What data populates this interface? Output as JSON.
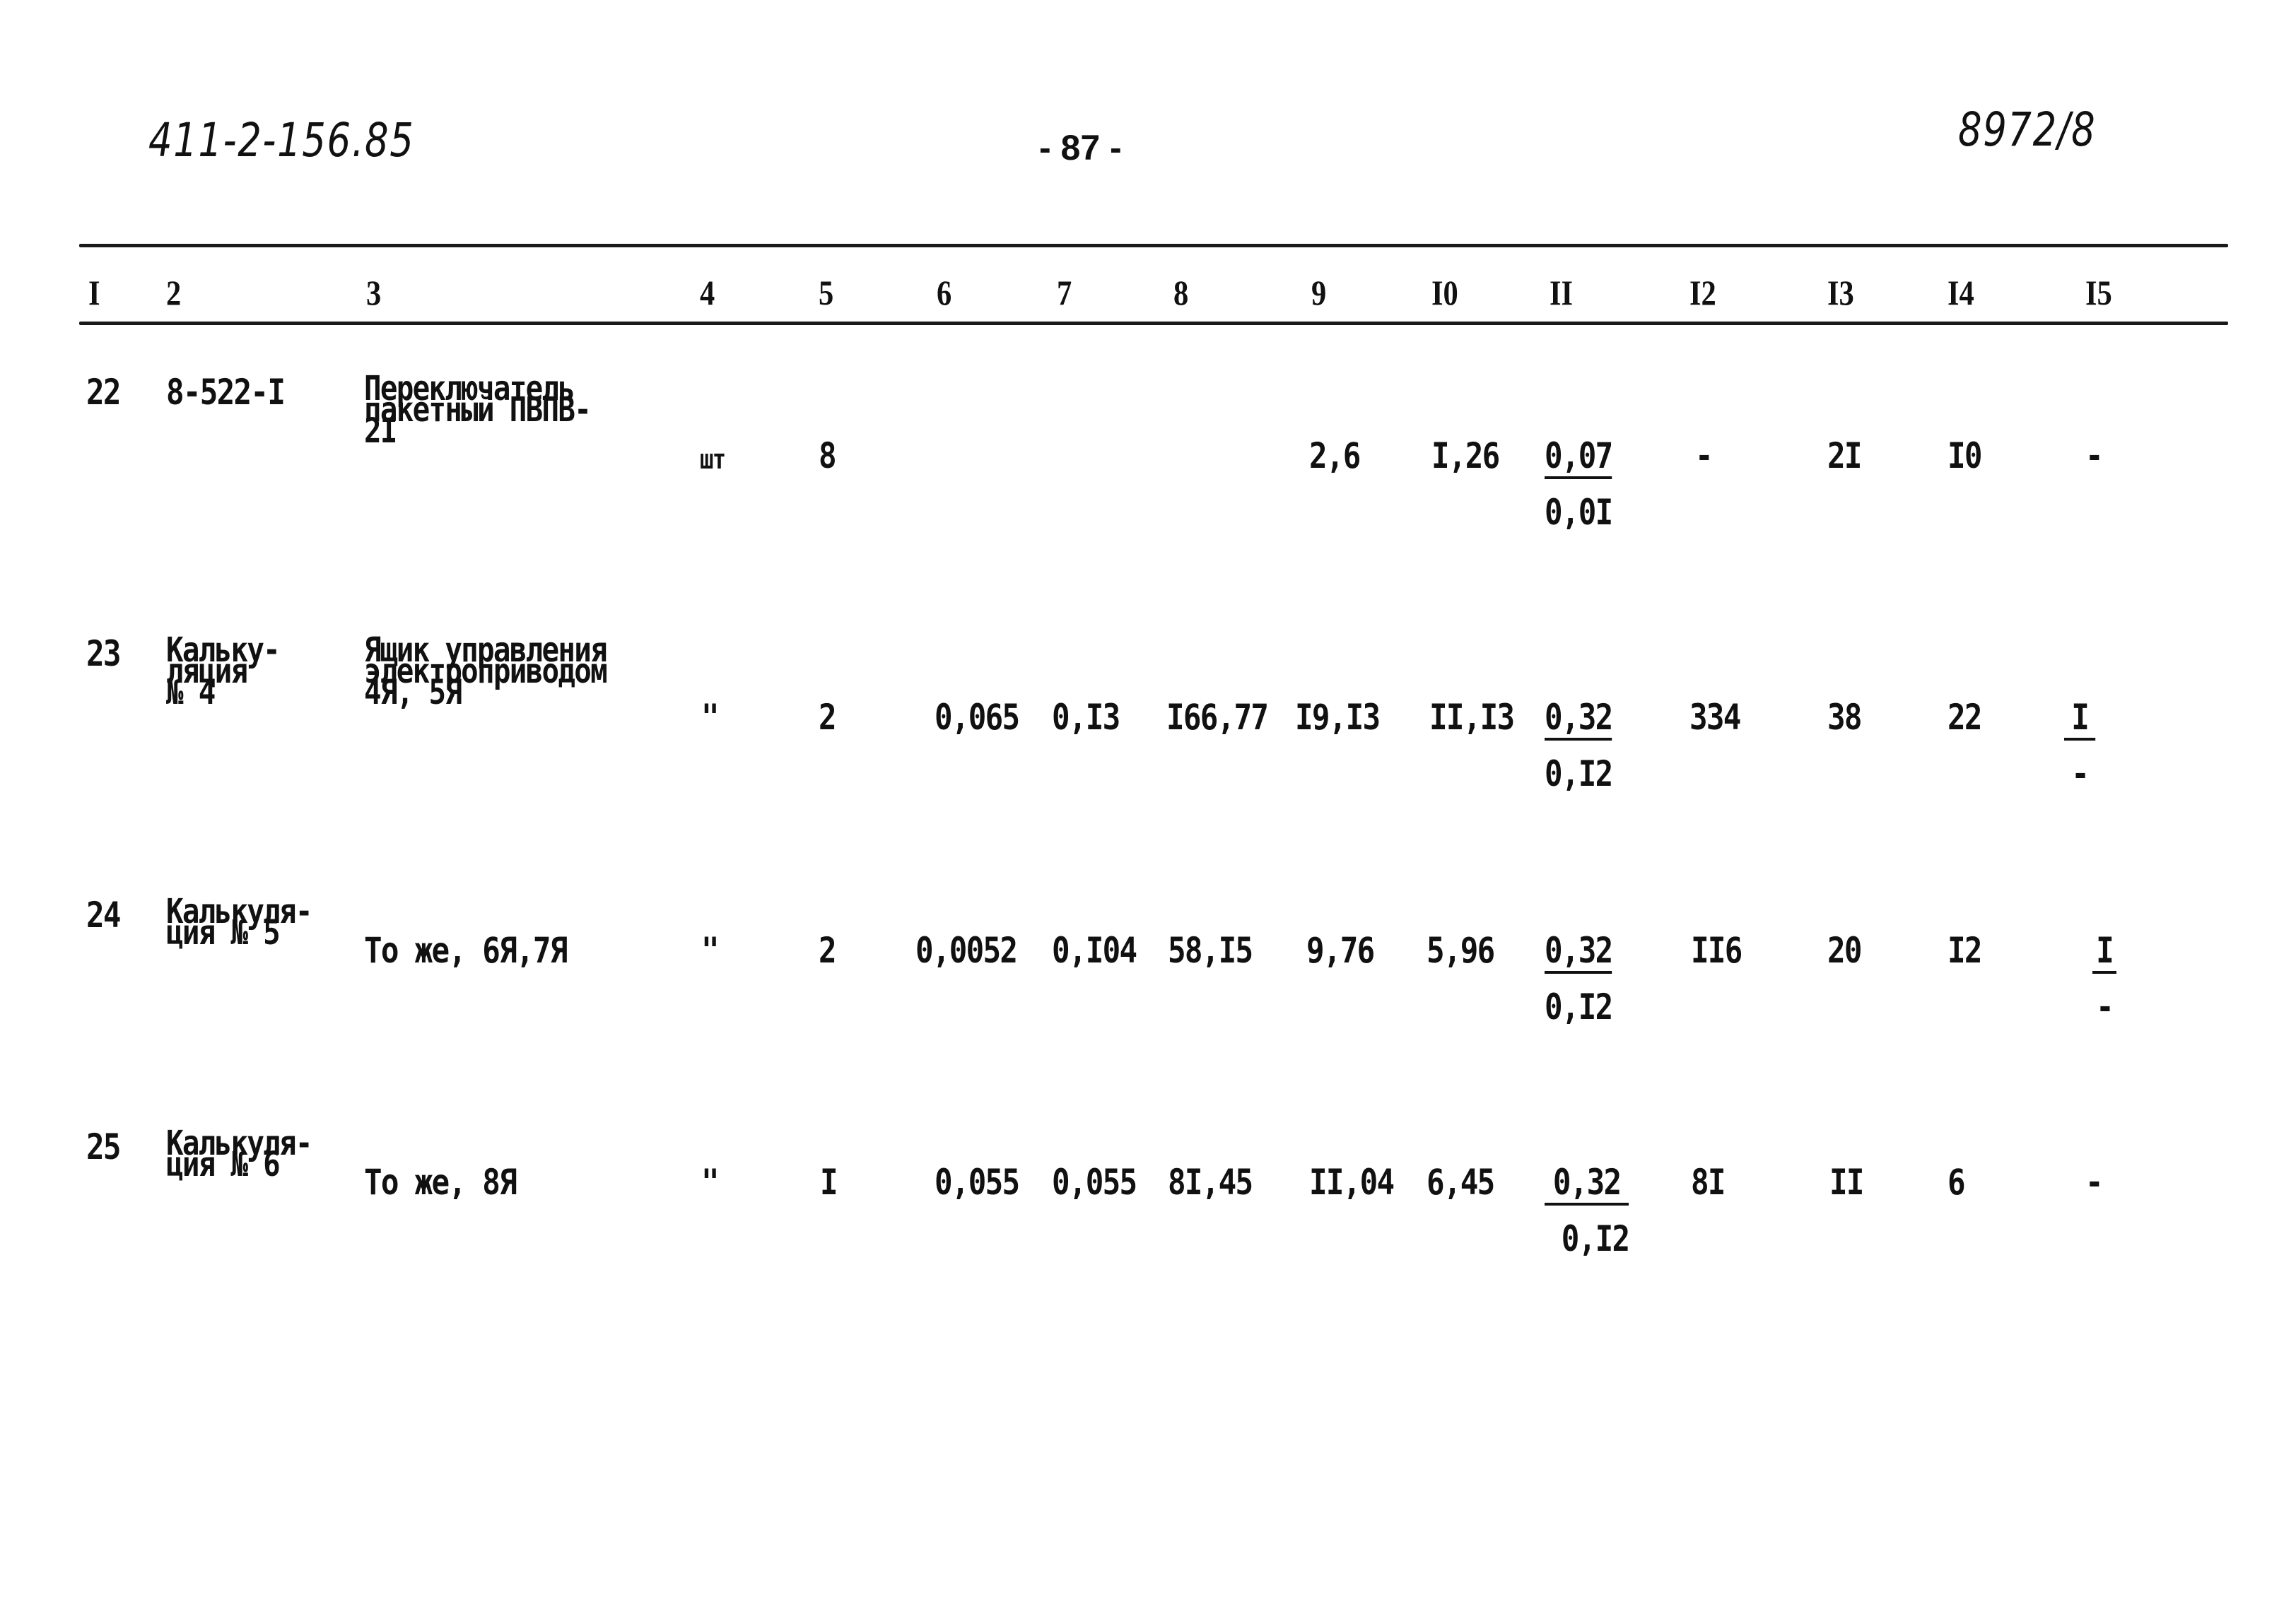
{
  "header": {
    "doc_code": "411-2-156.85",
    "page_number": "- 87 -",
    "sheet_ref": "8972/8"
  },
  "table": {
    "columns": [
      "I",
      "2",
      "3",
      "4",
      "5",
      "6",
      "7",
      "8",
      "9",
      "I0",
      "II",
      "I2",
      "I3",
      "I4",
      "I5"
    ],
    "rows": [
      {
        "c1": "22",
        "c2": "8-522-I",
        "c3": "Переключатель\nпакетный ПВПВ-\n2I",
        "c4": "шт",
        "c5": "8",
        "c6": "",
        "c7": "",
        "c8": "",
        "c9": "2,6",
        "c10": "I,26",
        "c11_num": "0,07",
        "c11_den": "0,0I",
        "c12": "-",
        "c13": "2I",
        "c14": "I0",
        "c15_num": "-",
        "c15_den": ""
      },
      {
        "c1": "23",
        "c2": "Кальку-\nляция\n№ 4",
        "c3": "Ящик управления\nэлектроприводом\n4Я, 5Я",
        "c4": "\"",
        "c5": "2",
        "c6": "0,065",
        "c7": "0,I3",
        "c8": "I66,77",
        "c9": "I9,I3",
        "c10": "II,I3",
        "c11_num": "0,32",
        "c11_den": "0,I2",
        "c12": "334",
        "c13": "38",
        "c14": "22",
        "c15_num": "I",
        "c15_den": "-"
      },
      {
        "c1": "24",
        "c2": "Калькуля-\nция № 5",
        "c3": "То же, 6Я,7Я",
        "c4": "\"",
        "c5": "2",
        "c6": "0,0052",
        "c7": "0,I04",
        "c8": "58,I5",
        "c9": "9,76",
        "c10": "5,96",
        "c11_num": "0,32",
        "c11_den": "0,I2",
        "c12": "II6",
        "c13": "20",
        "c14": "I2",
        "c15_num": "I",
        "c15_den": "-"
      },
      {
        "c1": "25",
        "c2": "Калькуля-\nция № 6",
        "c3": "То же, 8Я",
        "c4": "\"",
        "c5": "I",
        "c6": "0,055",
        "c7": "0,055",
        "c8": "8I,45",
        "c9": "II,04",
        "c10": "6,45",
        "c11_num": "0,32",
        "c11_den": "0,I2",
        "c12": "8I",
        "c13": "II",
        "c14": "6",
        "c15_num": "-",
        "c15_den": ""
      }
    ]
  }
}
